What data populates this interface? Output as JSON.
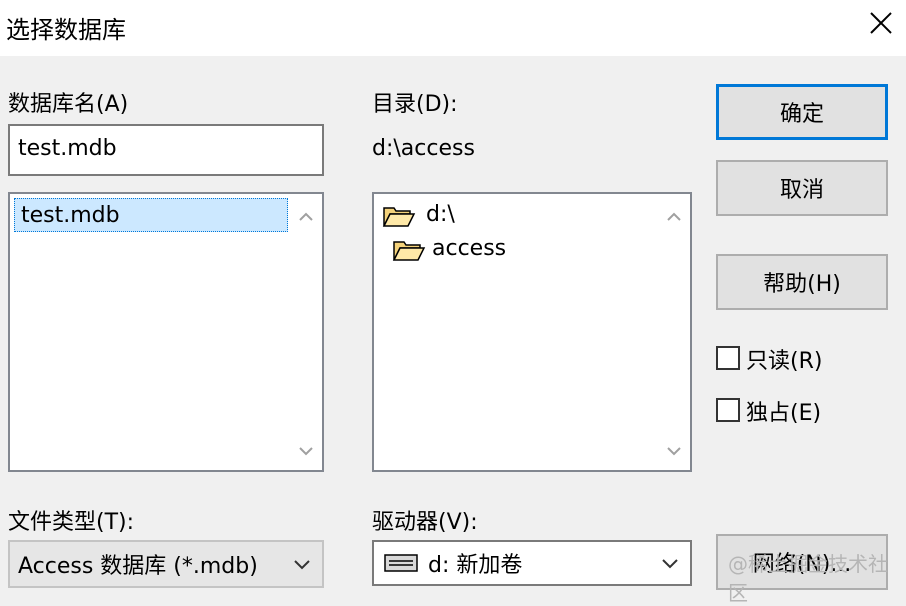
{
  "dialog": {
    "title": "选择数据库"
  },
  "database": {
    "label": "数据库名(A)",
    "input_value": "test.mdb",
    "list_items": [
      "test.mdb"
    ]
  },
  "directory": {
    "label": "目录(D):",
    "current_path": "d:\\access",
    "tree": [
      {
        "label": "d:\\",
        "icon": "open-folder-icon"
      },
      {
        "label": "access",
        "icon": "open-folder-icon"
      }
    ]
  },
  "buttons": {
    "ok": "确定",
    "cancel": "取消",
    "help": "帮助(H)",
    "network": "网络(N)..."
  },
  "options": {
    "readonly": "只读(R)",
    "exclusive": "独占(E)"
  },
  "file_type": {
    "label": "文件类型(T):",
    "value": "Access 数据库 (*.mdb)"
  },
  "drives": {
    "label": "驱动器(V):",
    "value": "d: 新加卷"
  },
  "watermark": "@稀土掘金技术社区",
  "colors": {
    "accent": "#0078d7",
    "selection": "#cce8ff"
  }
}
